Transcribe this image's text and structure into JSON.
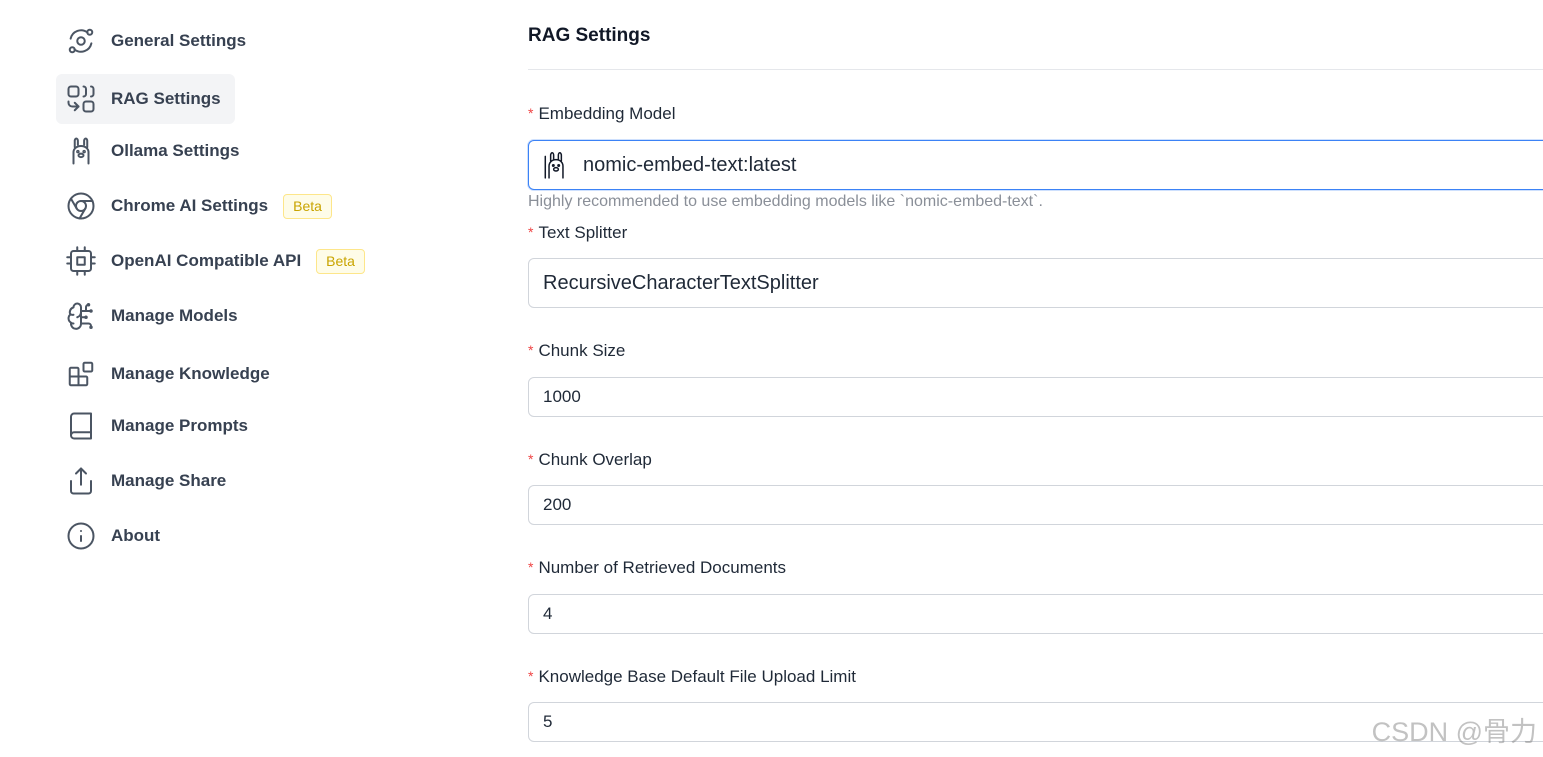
{
  "sidebar": {
    "items": [
      {
        "label": "General Settings",
        "icon": "orbit-icon"
      },
      {
        "label": "RAG Settings",
        "icon": "combine-icon",
        "active": true
      },
      {
        "label": "Ollama Settings",
        "icon": "llama-icon"
      },
      {
        "label": "Chrome AI Settings",
        "icon": "chrome-icon",
        "badge": "Beta"
      },
      {
        "label": "OpenAI Compatible API",
        "icon": "cpu-icon",
        "badge": "Beta"
      },
      {
        "label": "Manage Models",
        "icon": "brain-icon"
      },
      {
        "label": "Manage Knowledge",
        "icon": "blocks-icon"
      },
      {
        "label": "Manage Prompts",
        "icon": "book-icon"
      },
      {
        "label": "Manage Share",
        "icon": "share-icon"
      },
      {
        "label": "About",
        "icon": "info-icon"
      }
    ]
  },
  "main": {
    "title": "RAG Settings",
    "required_mark": "*",
    "embedding_model": {
      "label": "Embedding Model",
      "value": "nomic-embed-text:latest",
      "help": "Highly recommended to use embedding models like `nomic-embed-text`."
    },
    "text_splitter": {
      "label": "Text Splitter",
      "value": "RecursiveCharacterTextSplitter"
    },
    "chunk_size": {
      "label": "Chunk Size",
      "value": "1000"
    },
    "chunk_overlap": {
      "label": "Chunk Overlap",
      "value": "200"
    },
    "retrieved_docs": {
      "label": "Number of Retrieved Documents",
      "value": "4"
    },
    "upload_limit": {
      "label": "Knowledge Base Default File Upload Limit",
      "value": "5"
    }
  },
  "watermark": "CSDN @骨力",
  "colors": {
    "active_bg": "#f3f4f6",
    "focus_border": "#3b82f6",
    "required": "#ef4444",
    "badge_text": "#c9a400",
    "badge_bg": "#fefce8"
  }
}
